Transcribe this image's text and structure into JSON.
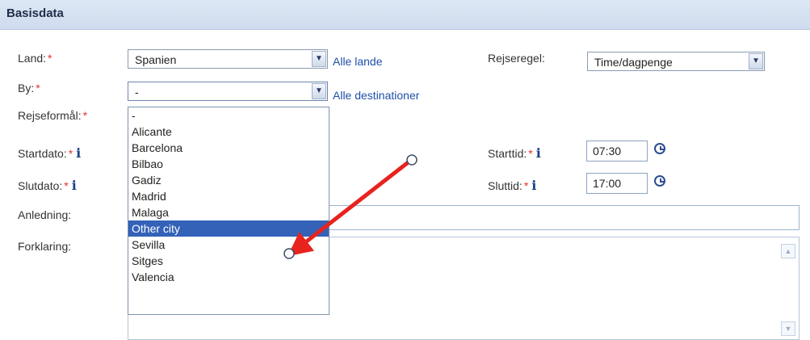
{
  "section_title": "Basisdata",
  "required_mark": "*",
  "info_glyph": "i",
  "labels": {
    "land": "Land:",
    "by": "By:",
    "rejseformaal": "Rejseformål:",
    "startdato": "Startdato:",
    "slutdato": "Slutdato:",
    "anledning": "Anledning:",
    "forklaring": "Forklaring:",
    "rejseregel": "Rejseregel:",
    "starttid": "Starttid:",
    "sluttid": "Sluttid:"
  },
  "land_select": {
    "value": "Spanien"
  },
  "by_select": {
    "value": "-"
  },
  "rejseregel_select": {
    "value": "Time/dagpenge"
  },
  "links": {
    "alle_lande": "Alle lande",
    "alle_destinationer": "Alle destinationer"
  },
  "times": {
    "start": "07:30",
    "end": "17:00"
  },
  "city_options": [
    "-",
    "Alicante",
    "Barcelona",
    "Bilbao",
    "Gadiz",
    "Madrid",
    "Malaga",
    "Other city",
    "Sevilla",
    "Sitges",
    "Valencia"
  ],
  "highlighted_option": "Other city",
  "colors": {
    "header_bg": "#cfdcee",
    "highlight": "#3362b8",
    "annotation_arrow": "#e8231e",
    "required": "#e03030"
  }
}
